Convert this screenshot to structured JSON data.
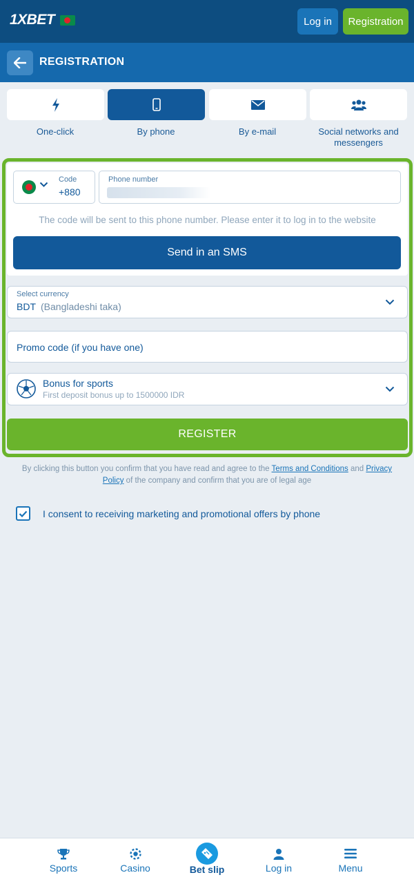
{
  "header": {
    "logo_text": "1XBET",
    "login_label": "Log in",
    "registration_label": "Registration"
  },
  "subheader": {
    "title": "REGISTRATION"
  },
  "tabs": [
    {
      "label": "One-click",
      "icon": "lightning-icon"
    },
    {
      "label": "By phone",
      "icon": "phone-icon",
      "active": true
    },
    {
      "label": "By e-mail",
      "icon": "envelope-icon"
    },
    {
      "label": "Social networks and messengers",
      "icon": "people-icon"
    }
  ],
  "phone_form": {
    "code_label": "Code",
    "code_value": "+880",
    "phone_label": "Phone number",
    "hint": "The code will be sent to this phone number. Please enter it to log in to the website",
    "send_sms_label": "Send in an SMS"
  },
  "currency": {
    "label": "Select currency",
    "code": "BDT",
    "name": "(Bangladeshi taka)"
  },
  "promo": {
    "placeholder": "Promo code (if you have one)"
  },
  "bonus": {
    "title": "Bonus for sports",
    "subtitle": "First deposit bonus up to 1500000 IDR"
  },
  "register_label": "REGISTER",
  "legal": {
    "prefix": "By clicking this button you confirm that you have read and agree to the ",
    "terms_link": "Terms and Conditions",
    "and": " and ",
    "privacy_link": "Privacy Policy",
    "suffix": " of the company and confirm that you are of legal age"
  },
  "consent": {
    "checked": true,
    "label": "I consent to receiving marketing and promotional offers by phone"
  },
  "bottom_nav": {
    "sports": "Sports",
    "casino": "Casino",
    "bet_slip": "Bet slip",
    "login": "Log in",
    "menu": "Menu"
  },
  "colors": {
    "header_bg": "#0d4d80",
    "subheader_bg": "#1569ad",
    "primary": "#12599a",
    "accent_green": "#6ab42c",
    "page_bg": "#e9eef3"
  }
}
